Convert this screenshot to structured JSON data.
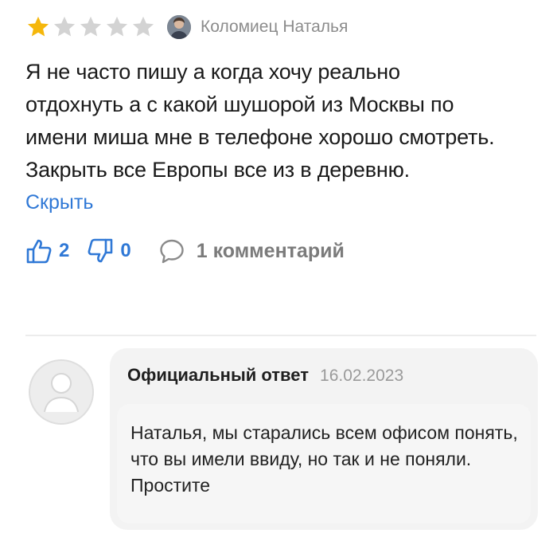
{
  "review": {
    "rating": 1,
    "max_rating": 5,
    "colors": {
      "star_filled": "#f5b70b",
      "star_empty": "#d3d3d3",
      "link": "#2f78d6"
    },
    "author_name": "Коломиец Наталья",
    "text": "Я не часто пишу а когда хочу реально отдохнуть а с какой шушорой из Москвы по имени миша мне в телефоне хорошо смотреть.  Закрыть все Европы все из в деревню.",
    "hide_label": "Скрыть",
    "likes": "2",
    "dislikes": "0",
    "comments_label": "1 комментарий"
  },
  "reply": {
    "title": "Официальный ответ",
    "date": "16.02.2023",
    "text": "Наталья, мы старались всем офисом понять, что вы имели ввиду, но так и не поняли. Простите"
  }
}
